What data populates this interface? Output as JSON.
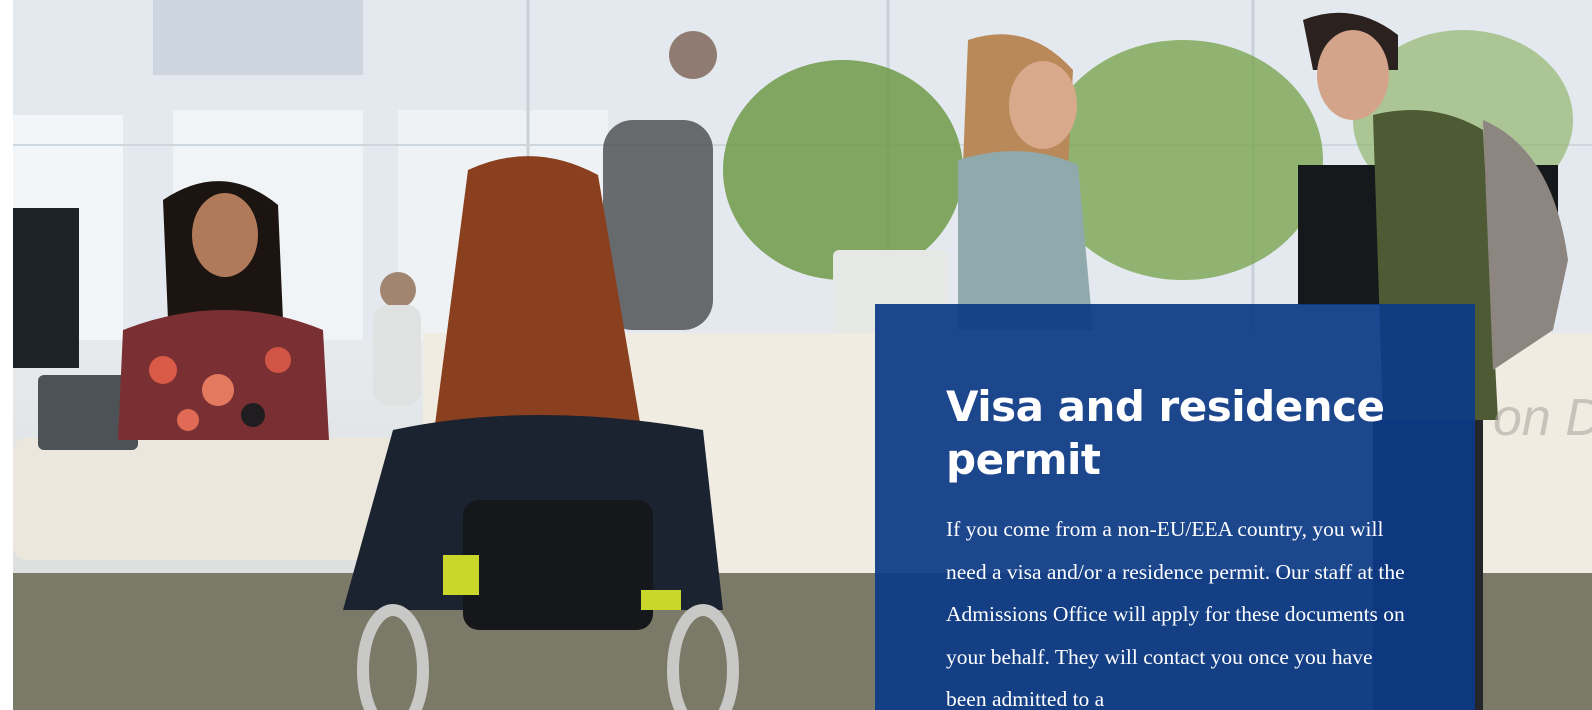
{
  "article": {
    "heading": "Visa and residence permit",
    "body": "If you come from a non-EU/EEA country, you will need a visa and/or a residence permit. Our staff at the Admissions Office will apply for these documents on your behalf. They will contact you once you have been admitted to a"
  },
  "photo": {
    "wall_sign_text": "on D"
  },
  "colors": {
    "panel_background": "#0c3a87",
    "panel_text": "#ffffff"
  }
}
